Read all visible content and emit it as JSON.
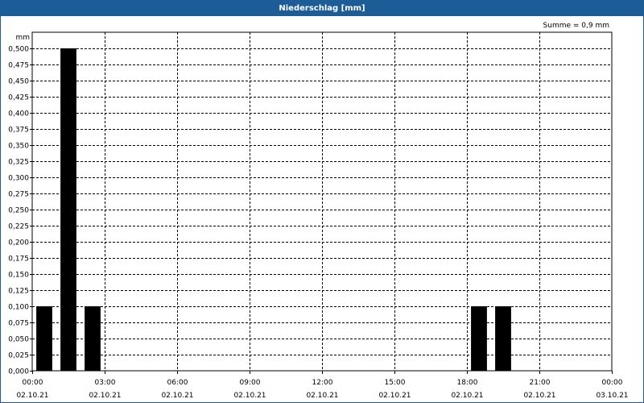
{
  "window": {
    "title": "Niederschlag [mm]"
  },
  "colors": {
    "titlebar": "#1c5d97",
    "bars": "#000000",
    "grid": "#000000"
  },
  "chart_data": {
    "type": "bar",
    "title": "Niederschlag [mm]",
    "ylabel": "mm",
    "annotation": "Summe = 0,9 mm",
    "ylim": [
      0,
      0.5
    ],
    "ytick_step": 0.025,
    "grid": true,
    "x_range_hours": [
      0,
      24
    ],
    "x_ticks": [
      {
        "hour": 0,
        "time": "00:00",
        "date": "02.10.21"
      },
      {
        "hour": 3,
        "time": "03:00",
        "date": "02.10.21"
      },
      {
        "hour": 6,
        "time": "06:00",
        "date": "02.10.21"
      },
      {
        "hour": 9,
        "time": "09:00",
        "date": "02.10.21"
      },
      {
        "hour": 12,
        "time": "12:00",
        "date": "02.10.21"
      },
      {
        "hour": 15,
        "time": "15:00",
        "date": "02.10.21"
      },
      {
        "hour": 18,
        "time": "18:00",
        "date": "02.10.21"
      },
      {
        "hour": 21,
        "time": "21:00",
        "date": "02.10.21"
      },
      {
        "hour": 24,
        "time": "00:00",
        "date": "03.10.21"
      }
    ],
    "bars": [
      {
        "start": 0,
        "end": 1,
        "value": 0.1
      },
      {
        "start": 1,
        "end": 2,
        "value": 0.5
      },
      {
        "start": 2,
        "end": 3,
        "value": 0.1
      },
      {
        "start": 18,
        "end": 19,
        "value": 0.1
      },
      {
        "start": 19,
        "end": 20,
        "value": 0.1
      }
    ]
  }
}
